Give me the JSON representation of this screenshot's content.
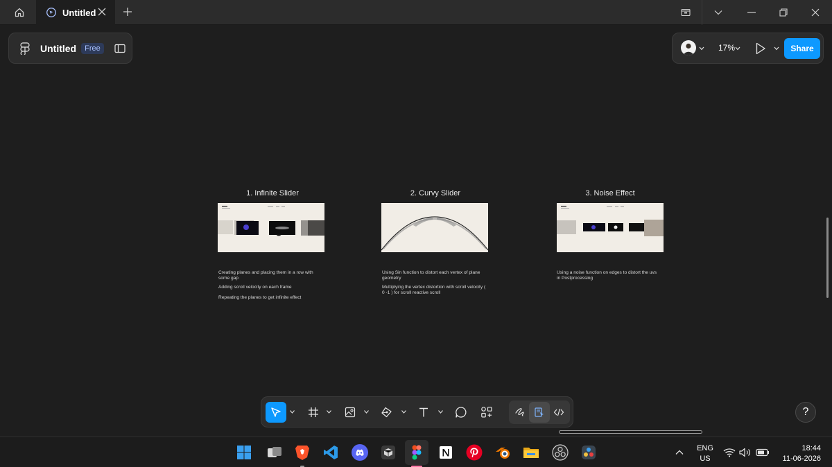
{
  "browser": {
    "tab_title": "Untitled"
  },
  "file_panel": {
    "title": "Untitled",
    "plan_badge": "Free"
  },
  "share_panel": {
    "zoom": "17%",
    "share_label": "Share"
  },
  "canvas": {
    "frames": [
      {
        "title": "1. Infinite Slider",
        "notes": [
          "Creating planes and placing them in a row with some gap",
          "Adding scroll velocity on each frame",
          "Repeating the planes to get infinite effect"
        ]
      },
      {
        "title": "2. Curvy Slider",
        "notes": [
          "Using Sin function to distort each vertex of plane geometry",
          "Multiplying the vertex distortion with scroll velocity ( 0 -1 ) for scroll reactive scroll"
        ]
      },
      {
        "title": "3. Noise Effect",
        "notes": [
          "Using a noise function on edges to distort the uvs in Postprocessing"
        ]
      }
    ]
  },
  "help_label": "?",
  "toolbar": {
    "tools": [
      "move-tool",
      "frame-tool",
      "image-tool",
      "pen-tool",
      "text-tool",
      "comment-tool",
      "actions-tool"
    ],
    "dev_tools": [
      "draw-mode",
      "design-mode",
      "dev-mode"
    ]
  },
  "taskbar": {
    "apps": [
      "windows-start",
      "task-view",
      "brave",
      "vscode",
      "discord",
      "app-cube",
      "figma",
      "notion",
      "pinterest",
      "blender",
      "file-explorer",
      "obs",
      "davinci-resolve"
    ],
    "lang_line1": "ENG",
    "lang_line2": "US",
    "time": "18:44",
    "date": "11-06-2026"
  },
  "colors": {
    "accent": "#0d99ff",
    "canvas_bg": "#1e1e1e",
    "panel_bg": "#2c2c2c"
  }
}
